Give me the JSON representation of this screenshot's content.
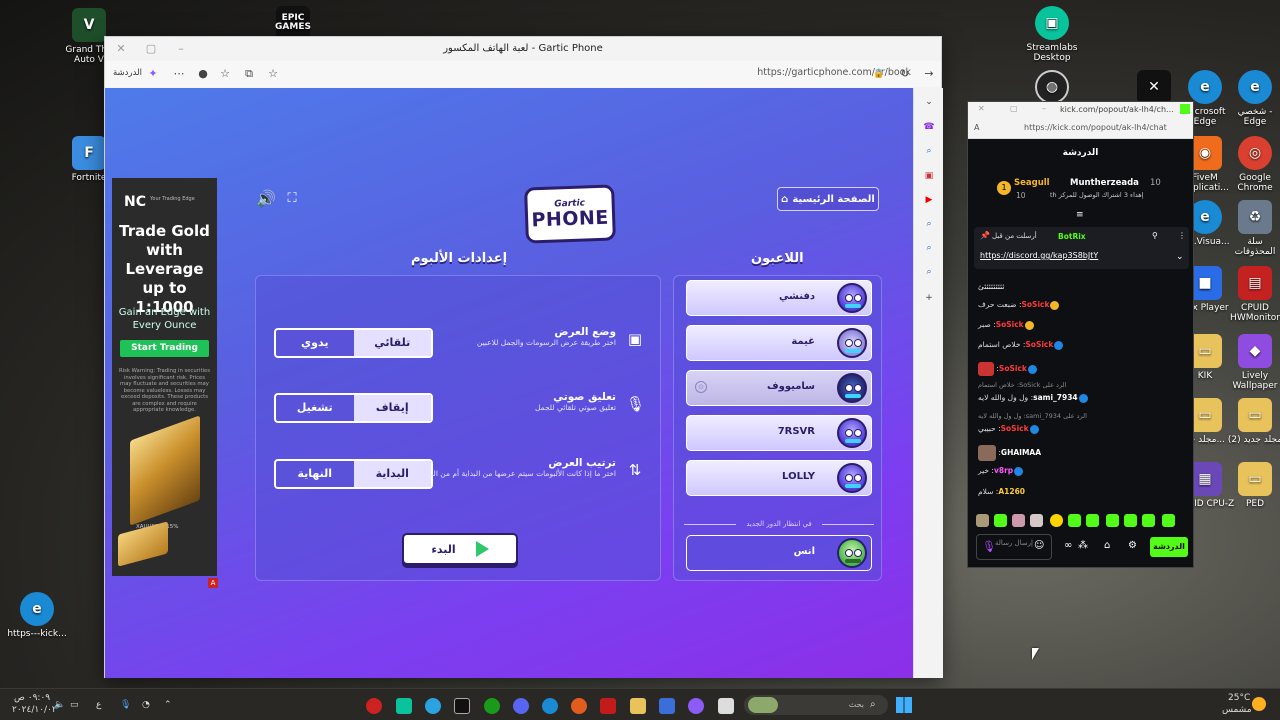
{
  "desktop": {
    "icons_left": [
      {
        "label": "Grand The\nAuto V",
        "badge": "V",
        "color": "#1e4f2a"
      },
      {
        "label": "Fortnite",
        "badge": "F",
        "color": "#3a8de0"
      },
      {
        "label": "https---kick...",
        "badge": "e",
        "color": "#1a8ad4"
      }
    ],
    "epic_label": "EPIC\nGAMES",
    "icons_right": [
      {
        "label": "Streamlabs\nDesktop",
        "badge": "▣",
        "color": "#09c39c"
      },
      {
        "label": "Microsoft\nEdge",
        "badge": "e",
        "color": "#1a8ad4"
      },
      {
        "label": "شخصي -\nEdge",
        "badge": "e",
        "color": "#1a8ad4"
      },
      {
        "label": "FiveM\nApplicati...",
        "badge": "◉",
        "color": "#ef6c1d"
      },
      {
        "label": "Google\nChrome",
        "badge": "◎",
        "color": "#d9402f"
      },
      {
        "label": "MS.Visua...",
        "badge": "e",
        "color": "#1a8ad4"
      },
      {
        "label": "سلة\nالمحذوفات",
        "badge": "🗑",
        "color": "#6a7a8c"
      },
      {
        "label": "Rox Player",
        "badge": "■",
        "color": "#2a6ce6"
      },
      {
        "label": "CPUID\nHWMonitor",
        "badge": "▤",
        "color": "#c42121"
      },
      {
        "label": "KIK",
        "badge": "▭",
        "color": "#e8c35c"
      },
      {
        "label": "Lively\nWallpaper",
        "badge": "◆",
        "color": "#8e4de0"
      },
      {
        "label": "مجلد جد...",
        "badge": "▭",
        "color": "#e8c35c"
      },
      {
        "label": "مجلد جديد (2)",
        "badge": "▭",
        "color": "#e8c35c"
      },
      {
        "label": "CPUID CPU-Z",
        "badge": "▦",
        "color": "#6b48b8"
      },
      {
        "label": "PED",
        "badge": "▭",
        "color": "#e8c35c"
      }
    ]
  },
  "browser": {
    "title": "لعبة الهاتف المكسور - Gartic Phone",
    "url": "https://garticphone.com/ar/book",
    "chat_label": "الدردشة"
  },
  "ad": {
    "brand": "NC",
    "brand_sub": "Your Trading Edge",
    "headline": "Trade Gold with Leverage up to 1:1000",
    "subline": "Gain an Edge with Every Ounce",
    "cta": "Start Trading",
    "risk": "Risk Warning: Trading in securities involves significant risk. Prices may fluctuate and securities may become valueless. Losses may exceed deposits. These products are complex and require appropriate knowledge.",
    "ticker": "XAUUSD  0.15%"
  },
  "game": {
    "home_button": "الصفحة الرئيسية",
    "logo_top": "Gartic",
    "logo_main": "PHONE",
    "settings_title": "إعدادات الألبوم",
    "players_title": "اللاعبون",
    "settings": [
      {
        "title": "وضع العرض",
        "desc": "اختر طريقة عرض الرسومات والجمل للاعبين",
        "icon": "image-icon",
        "options": [
          "يدوي",
          "تلقائي"
        ],
        "selected": "تلقائي"
      },
      {
        "title": "تعليق صوتي",
        "desc": "تعليق صوتي تلقائي للجمل",
        "icon": "microphone-icon",
        "options": [
          "تشغيل",
          "إيقاف"
        ],
        "selected": "إيقاف"
      },
      {
        "title": "ترتيب العرض",
        "desc": "اختر ما إذا كانت الألبومات سيتم عرضها من البداية أم من النهاية",
        "icon": "sort-arrows-icon",
        "options": [
          "النهاية",
          "البداية"
        ],
        "selected": "البداية"
      }
    ],
    "start_button": "البدء",
    "players": [
      "دفنشي",
      "غيمة",
      "ساميووف",
      "7RSVR",
      "LOLLY"
    ],
    "host_player": "ساميووف",
    "waiting_label": "في انتظار الدور الجديد",
    "waiting_player": "انس"
  },
  "kick": {
    "url": "https://kick.com/popout/ak-lh4/chat",
    "title_url": "kick.com/popout/ak-lh4/ch...",
    "header": "الدردشة",
    "pinned_user": "Seagull",
    "pinned_name": "Muntherzeada",
    "pinned_count": "10",
    "pinned_left": "10",
    "pinned_desc": "إهداء 3 اشتراك الوصول للمركز th",
    "pin_by": "أرسلت من قبل",
    "pin_bot": "BotRix",
    "pin_link": "https://discord.gg/kap3S8bJtY",
    "messages": [
      {
        "user": "",
        "text": "ئئئئئئئئئئ"
      },
      {
        "user": "SoSick",
        "text": "ضبعت حرف"
      },
      {
        "user": "SoSick",
        "text": "صبر"
      },
      {
        "user": "SoSick",
        "text": "خلاص استمام"
      },
      {
        "user": "SoSick",
        "text": ""
      },
      {
        "user": "",
        "text": "الرد على SoSick: خلاص استمام"
      },
      {
        "user": "sami_7934",
        "text": "ول ول والله لايه"
      },
      {
        "user": "",
        "text": "الرد على sami_7934: ول ول والله لايه"
      },
      {
        "user": "SoSick",
        "text": "حبيبي"
      },
      {
        "user": "GHAIMAA",
        "text": ""
      },
      {
        "user": "v8rp",
        "text": "خير"
      },
      {
        "user": "A1260",
        "text": "سلام"
      }
    ],
    "chat_button": "الدردشة",
    "input_placeholder": "إرسال رسالة"
  },
  "taskbar": {
    "search_placeholder": "بحث",
    "time": "٠٩:٠٩ ص",
    "date": "٢٠٢٤/١٠/٠٢",
    "lang": "ع",
    "weather_temp": "25°C",
    "weather_desc": "مشمس"
  }
}
